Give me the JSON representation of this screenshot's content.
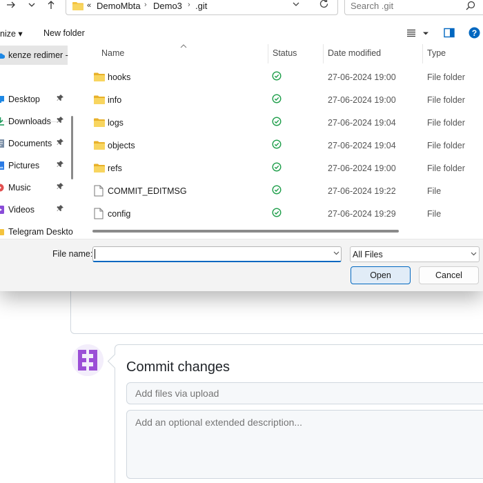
{
  "dialog": {
    "address": {
      "overflow": "«",
      "crumbs": [
        "DemoMbta",
        "Demo3",
        ".git"
      ],
      "separator": "›"
    },
    "search_placeholder": "Search .git",
    "commands": {
      "organize": "nize ▾",
      "new_folder": "New folder"
    },
    "nav": {
      "account": "kenze redimer -",
      "items": [
        {
          "label": "Desktop",
          "icon": "desktop-icon",
          "color": "#1e88e5"
        },
        {
          "label": "Downloads",
          "icon": "downloads-icon",
          "color": "#1c9a5a"
        },
        {
          "label": "Documents",
          "icon": "documents-icon",
          "color": "#7a8ea6"
        },
        {
          "label": "Pictures",
          "icon": "pictures-icon",
          "color": "#2c7be5"
        },
        {
          "label": "Music",
          "icon": "music-icon",
          "color": "#e25050"
        },
        {
          "label": "Videos",
          "icon": "videos-icon",
          "color": "#8a4cd8"
        },
        {
          "label": "Telegram Deskto",
          "icon": "folder-icon",
          "color": "#f4c33e"
        }
      ]
    },
    "columns": {
      "name": "Name",
      "status": "Status",
      "date": "Date modified",
      "type": "Type"
    },
    "files": [
      {
        "name": "hooks",
        "kind": "folder",
        "date": "27-06-2024 19:00",
        "type": "File folder"
      },
      {
        "name": "info",
        "kind": "folder",
        "date": "27-06-2024 19:00",
        "type": "File folder"
      },
      {
        "name": "logs",
        "kind": "folder",
        "date": "27-06-2024 19:04",
        "type": "File folder"
      },
      {
        "name": "objects",
        "kind": "folder",
        "date": "27-06-2024 19:04",
        "type": "File folder"
      },
      {
        "name": "refs",
        "kind": "folder",
        "date": "27-06-2024 19:00",
        "type": "File folder"
      },
      {
        "name": "COMMIT_EDITMSG",
        "kind": "file",
        "date": "27-06-2024 19:22",
        "type": "File"
      },
      {
        "name": "config",
        "kind": "file",
        "date": "27-06-2024 19:29",
        "type": "File"
      }
    ],
    "file_name_label": "File name:",
    "file_name_value": "",
    "file_type": "All Files",
    "open_label": "Open",
    "cancel_label": "Cancel"
  },
  "page": {
    "commit_title": "Commit changes",
    "summary_placeholder": "Add files via upload",
    "description_placeholder": "Add an optional extended description..."
  },
  "colors": {
    "accent": "#0067c0",
    "folder": "#f4c33e",
    "status_ok": "#1e9e4a",
    "avatar": "#9b4fd6"
  }
}
